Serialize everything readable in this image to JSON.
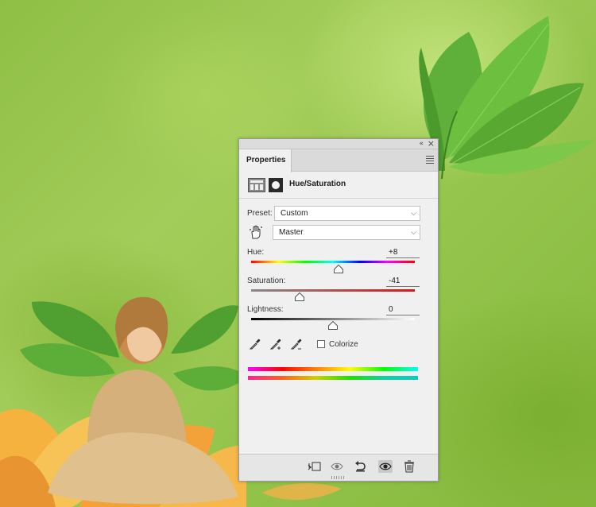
{
  "panel": {
    "tab_label": "Properties",
    "adjustment_title": "Hue/Saturation",
    "preset_label": "Preset:",
    "preset_value": "Custom",
    "channel_value": "Master",
    "hue": {
      "label": "Hue:",
      "value": "+8",
      "fraction": 0.535
    },
    "saturation": {
      "label": "Saturation:",
      "value": "-41",
      "fraction": 0.295
    },
    "lightness": {
      "label": "Lightness:",
      "value": "0",
      "fraction": 0.5
    },
    "colorize_label": "Colorize",
    "colorize_checked": false
  },
  "colors": {
    "panel_bg": "#f0f0f0",
    "scene_green": "#9cc94f",
    "leaf_green": "#4fa534",
    "flower_orange": "#f3a23a"
  },
  "icons": {
    "collapse": "«",
    "close": "×",
    "chevron": "⌵"
  }
}
